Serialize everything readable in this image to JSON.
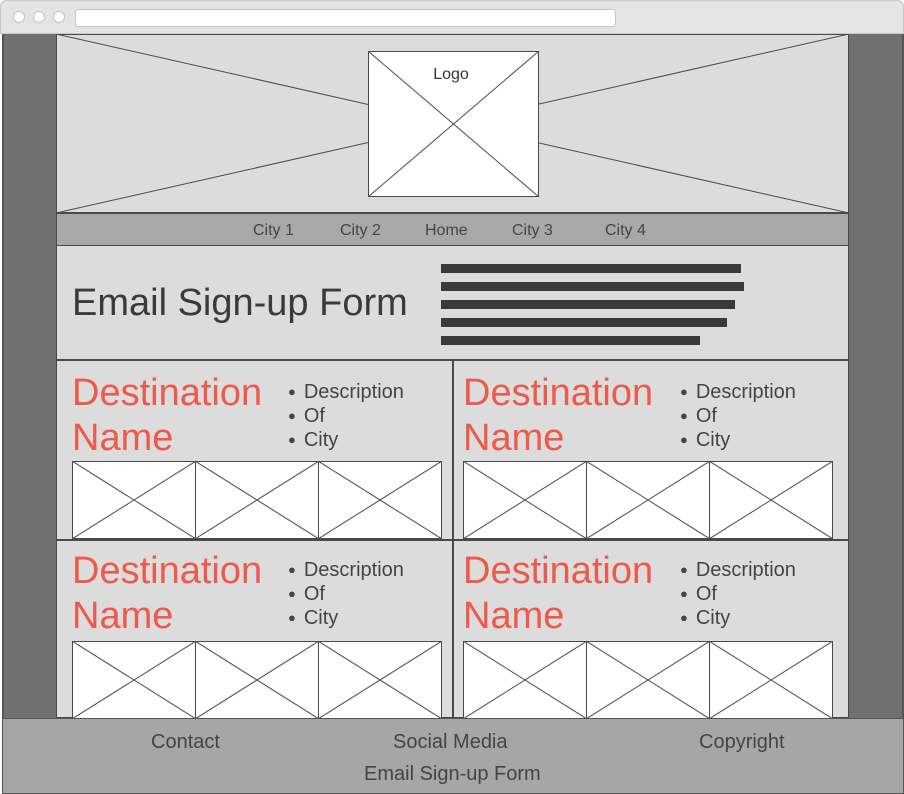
{
  "hero": {
    "logo_label": "Logo"
  },
  "nav": {
    "items": [
      "City 1",
      "City 2",
      "Home",
      "City 3",
      "City 4"
    ]
  },
  "signup": {
    "title": "Email Sign-up Form"
  },
  "cards": [
    {
      "name_line1": "Destination",
      "name_line2": "Name",
      "bullets": [
        "Description",
        "Of",
        "City"
      ]
    },
    {
      "name_line1": "Destination",
      "name_line2": "Name",
      "bullets": [
        "Description",
        "Of",
        "City"
      ]
    },
    {
      "name_line1": "Destination",
      "name_line2": "Name",
      "bullets": [
        "Description",
        "Of",
        "City"
      ]
    },
    {
      "name_line1": "Destination",
      "name_line2": "Name",
      "bullets": [
        "Description",
        "Of",
        "City"
      ]
    }
  ],
  "footer": {
    "contact": "Contact",
    "social": "Social Media",
    "copyright": "Copyright",
    "signup": "Email Sign-up Form"
  },
  "colors": {
    "accent": "#ee5a4a",
    "text": "#3a3a3a",
    "panel": "#dcdcdc",
    "bar": "#a8a8a8"
  }
}
